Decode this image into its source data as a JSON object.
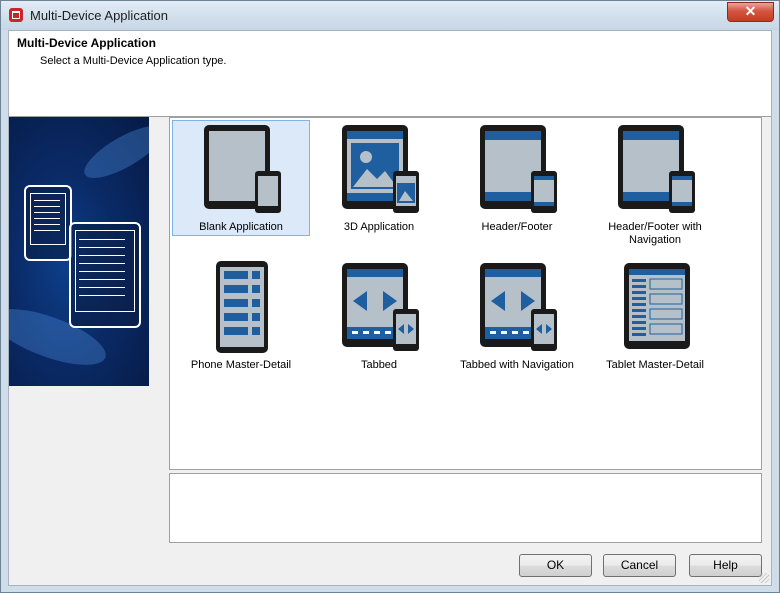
{
  "window": {
    "title": "Multi-Device Application",
    "close_label": "✕",
    "icons": {
      "app": "app-logo-icon",
      "close": "close-icon"
    }
  },
  "header": {
    "title": "Multi-Device Application",
    "subtitle": "Select a Multi-Device Application type."
  },
  "templates": [
    {
      "label": "Blank Application",
      "icon": "blank-application-icon",
      "selected": true
    },
    {
      "label": "3D Application",
      "icon": "3d-application-icon"
    },
    {
      "label": "Header/Footer",
      "icon": "header-footer-icon"
    },
    {
      "label": "Header/Footer with Navigation",
      "icon": "header-footer-navigation-icon"
    },
    {
      "label": "Phone Master-Detail",
      "icon": "phone-master-detail-icon"
    },
    {
      "label": "Tabbed",
      "icon": "tabbed-icon"
    },
    {
      "label": "Tabbed with Navigation",
      "icon": "tabbed-navigation-icon"
    },
    {
      "label": "Tablet Master-Detail",
      "icon": "tablet-master-detail-icon"
    }
  ],
  "description": "",
  "buttons": {
    "ok": "OK",
    "cancel": "Cancel",
    "help": "Help"
  },
  "colors": {
    "accent": "#1f5f9f",
    "selection": "#dbe9f8",
    "device_frame": "#1a1a1a",
    "screen": "#b5c0c9"
  }
}
